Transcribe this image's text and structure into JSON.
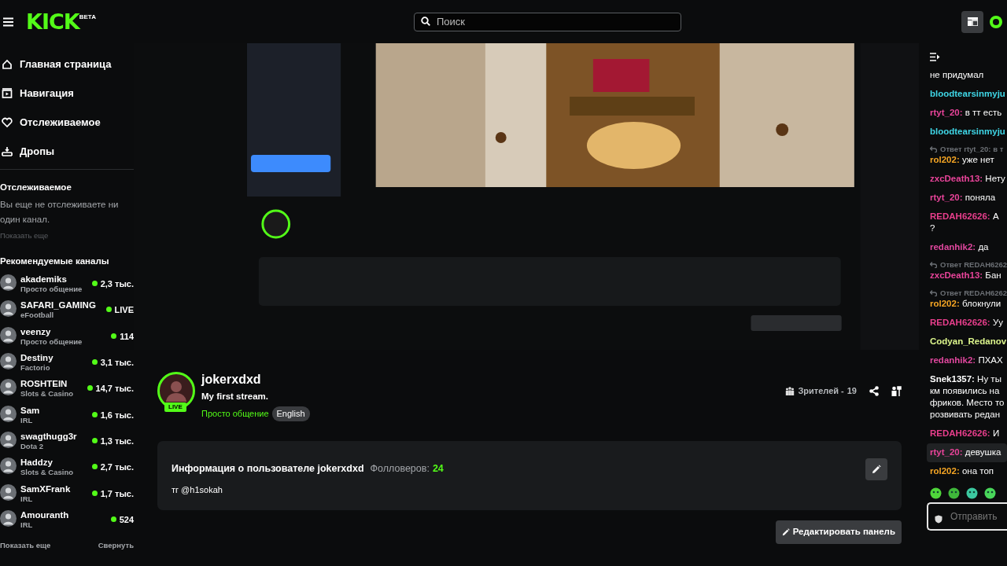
{
  "topbar": {
    "logo": "KICK",
    "logo_badge": "BETA",
    "search": {
      "placeholder": "Поиск"
    }
  },
  "sidebar": {
    "nav": [
      {
        "label": "Главная страница"
      },
      {
        "label": "Навигация"
      },
      {
        "label": "Отслеживаемое"
      },
      {
        "label": "Дропы"
      }
    ],
    "following": {
      "title": "Отслеживаемое",
      "empty_text": "Вы еще не отслеживаете ни один канал.",
      "show_more": "Показать еще"
    },
    "recommended": {
      "title": "Рекомендуемые каналы",
      "channels": [
        {
          "name": "akademiks",
          "category": "Просто общение",
          "viewers": "2,3 тыс."
        },
        {
          "name": "SAFARI_GAMING",
          "category": "eFootball",
          "viewers": "LIVE"
        },
        {
          "name": "veenzy",
          "category": "Просто общение",
          "viewers": "114"
        },
        {
          "name": "Destiny",
          "category": "Factorio",
          "viewers": "3,1 тыс."
        },
        {
          "name": "ROSHTEIN",
          "category": "Slots & Casino",
          "viewers": "14,7 тыс."
        },
        {
          "name": "Sam",
          "category": "IRL",
          "viewers": "1,6 тыс."
        },
        {
          "name": "swagthugg3r",
          "category": "Dota 2",
          "viewers": "1,3 тыс."
        },
        {
          "name": "Haddzy",
          "category": "Slots & Casino",
          "viewers": "2,7 тыс."
        },
        {
          "name": "SamXFrank",
          "category": "IRL",
          "viewers": "1,7 тыс."
        },
        {
          "name": "Amouranth",
          "category": "IRL",
          "viewers": "524"
        }
      ],
      "show_more": "Показать еще",
      "collapse": "Свернуть"
    }
  },
  "stream": {
    "username": "jokerxdxd",
    "title": "My first stream.",
    "live_badge": "LIVE",
    "category": "Просто общение",
    "language": "English",
    "viewers_label": "Зрителей -",
    "viewers": "19"
  },
  "about": {
    "title": "Информация о пользователе jokerxdxd",
    "followers_label": "Фолловеров:",
    "followers": "24",
    "text": "тг @h1sokah"
  },
  "edit_panel_button": "Редактировать панель",
  "chat": {
    "messages": [
      {
        "text": "не придумал",
        "highlighted": false
      },
      {
        "user": "bloodtearsinmyju",
        "color": "#3fd6e6",
        "highlighted": false
      },
      {
        "user": "rtyt_20:",
        "color": "#e9449a",
        "text": "в тт есть",
        "highlighted": false
      },
      {
        "user": "bloodtearsinmyju",
        "color": "#3fd6e6",
        "highlighted": false
      },
      {
        "reply": "Ответ rtyt_20: в т",
        "user": "rol202:",
        "color": "#f5a524",
        "text": "уже нет",
        "highlighted": false
      },
      {
        "user": "zxcDeath13:",
        "color": "#e9449a",
        "text": "Нету",
        "highlighted": false
      },
      {
        "user": "rtyt_20:",
        "color": "#e9449a",
        "text": "поняла",
        "highlighted": false
      },
      {
        "user": "REDAH62626:",
        "color": "#e83e8c",
        "text": "А\n?",
        "highlighted": false
      },
      {
        "user": "redanhik2:",
        "color": "#e0479e",
        "text": "да",
        "highlighted": false
      },
      {
        "reply": "Ответ REDAH6262",
        "user": "zxcDeath13:",
        "color": "#e9449a",
        "text": "Бан",
        "highlighted": false
      },
      {
        "reply": "Ответ REDAH6262",
        "user": "rol202:",
        "color": "#f5a524",
        "text": "блокнули",
        "highlighted": false
      },
      {
        "user": "REDAH62626:",
        "color": "#e83e8c",
        "text": "Уу",
        "highlighted": false
      },
      {
        "user": "Codyan_Redanov",
        "color": "#dcf58c",
        "highlighted": false
      },
      {
        "user": "redanhik2:",
        "color": "#e0479e",
        "text": "ПХАХ",
        "highlighted": false
      },
      {
        "user": "Snek1357:",
        "color": "#ffffff",
        "text": "Ну ты\nкм появились на\nфриков. Место то\nрозвивать редан",
        "highlighted": false
      },
      {
        "user": "REDAH62626:",
        "color": "#e83e8c",
        "text": "И",
        "highlighted": false
      },
      {
        "user": "rtyt_20:",
        "color": "#e9449a",
        "text": "девушка",
        "highlighted": true
      },
      {
        "user": "rol202:",
        "color": "#f5a524",
        "text": "она топ",
        "highlighted": false
      }
    ],
    "input": {
      "placeholder": "Отправить"
    }
  }
}
